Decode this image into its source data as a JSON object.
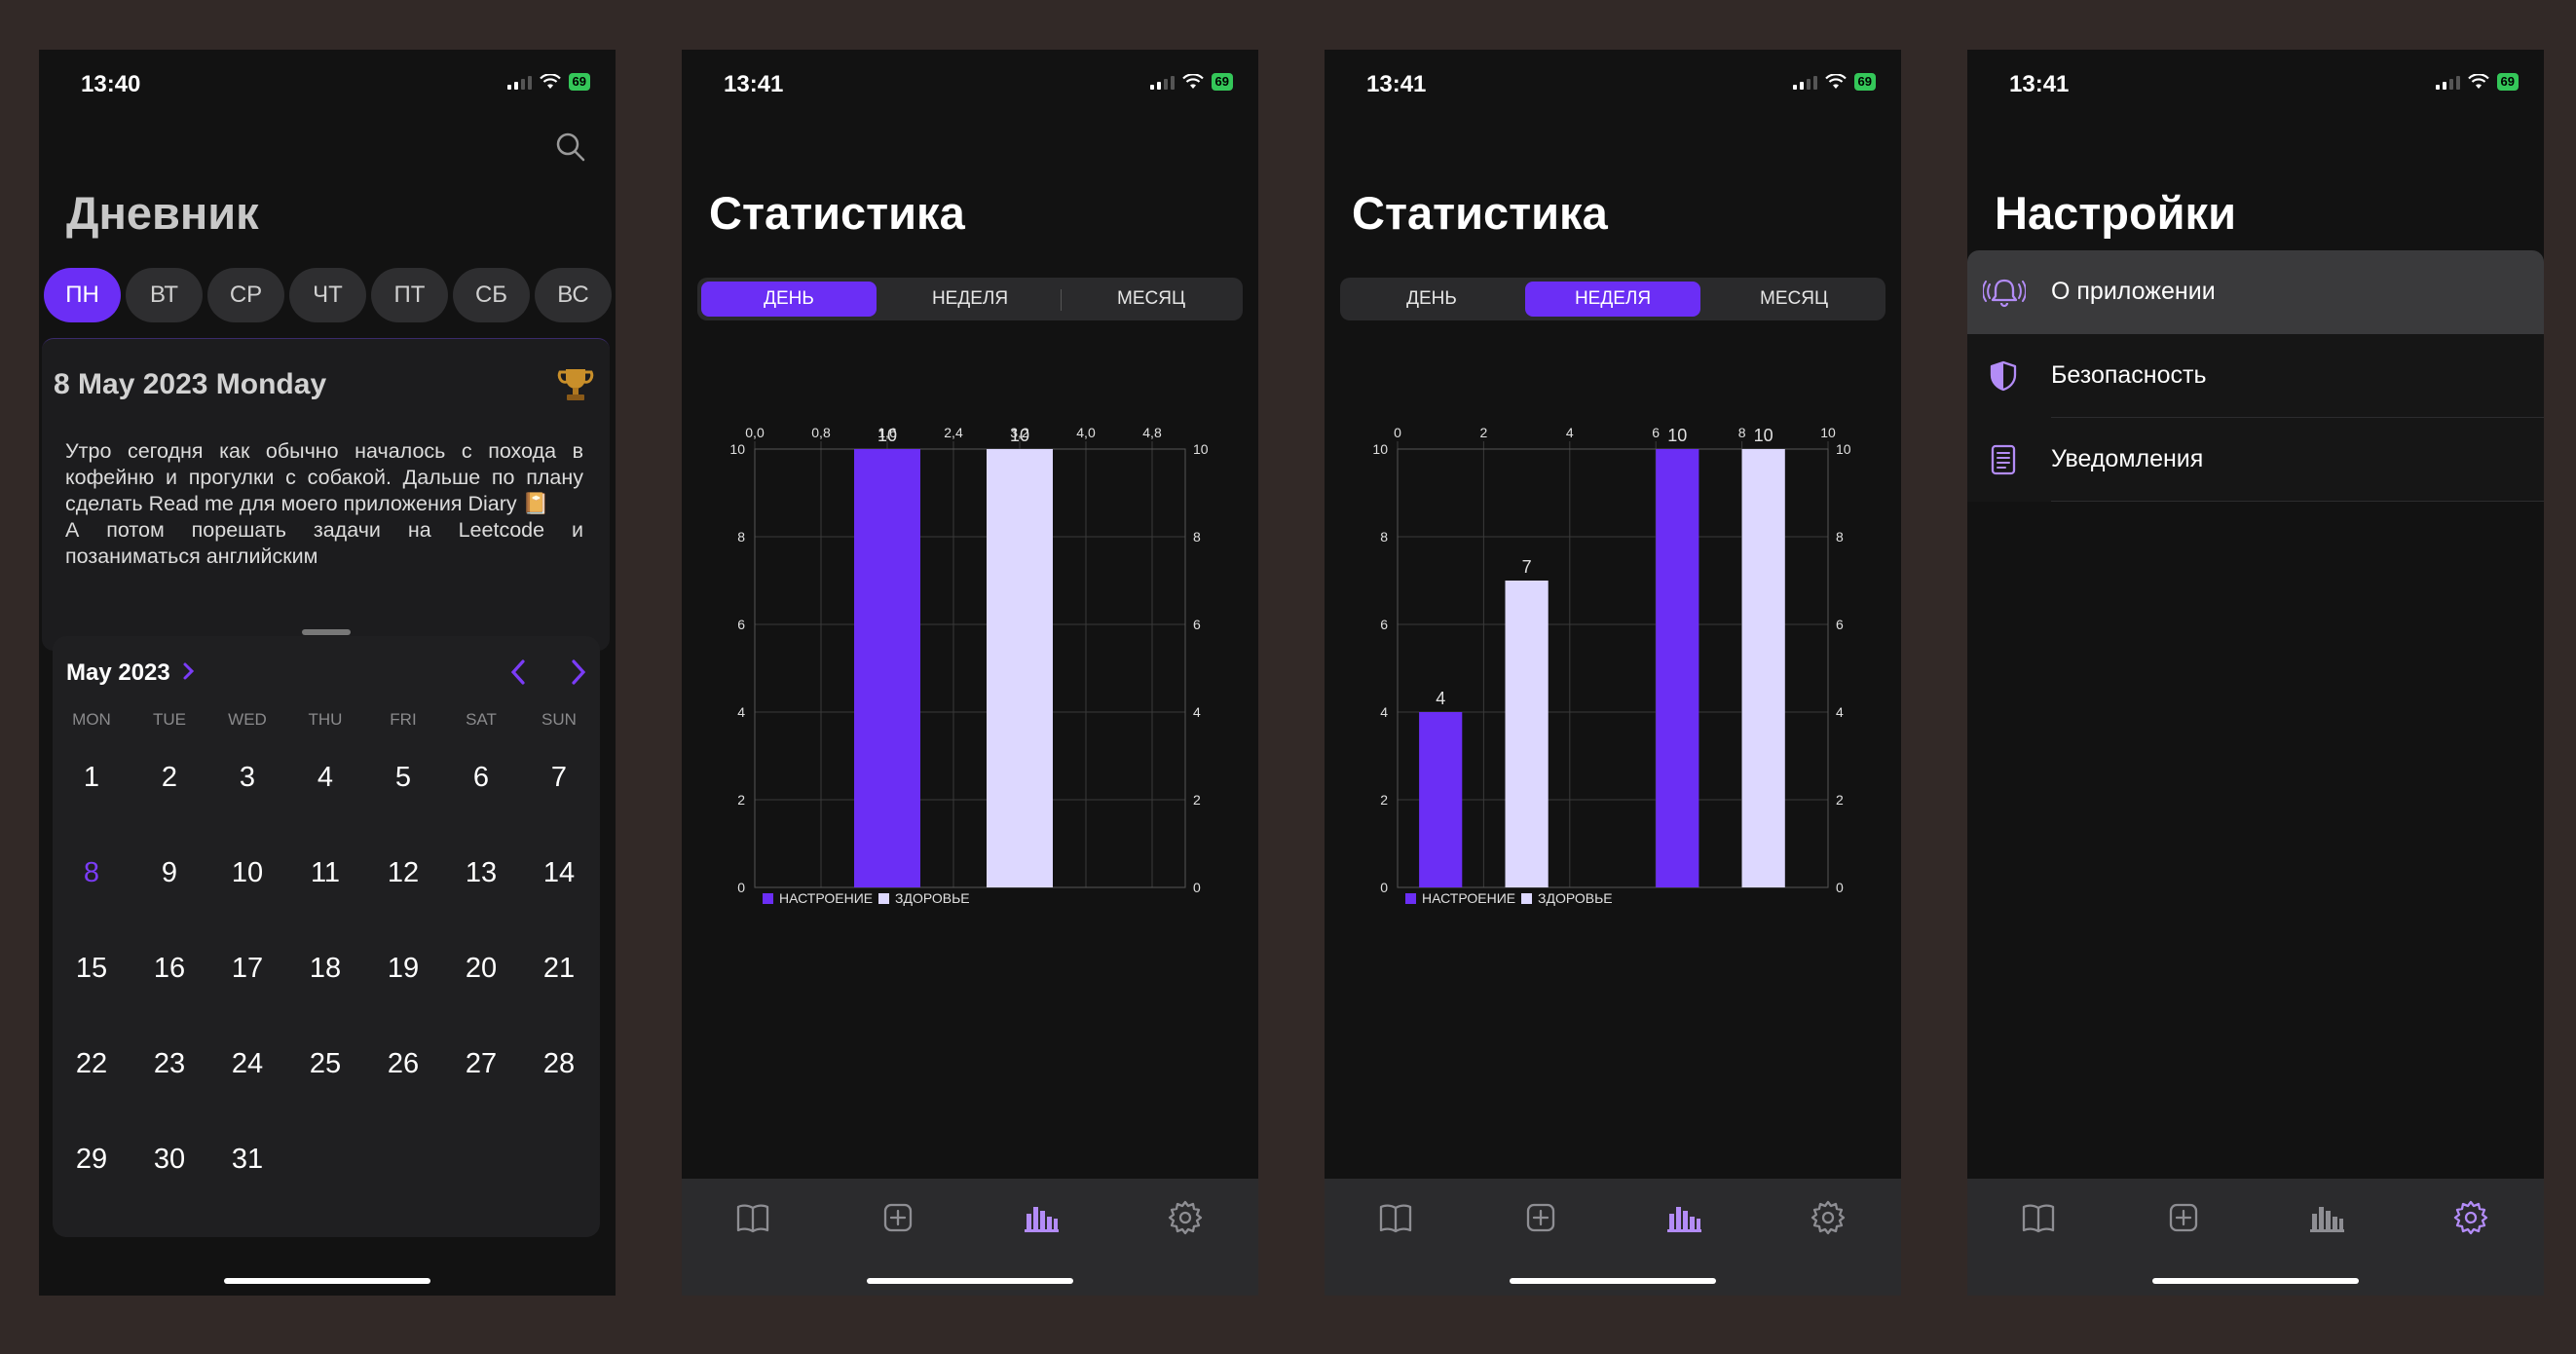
{
  "screens": {
    "diary": {
      "time": "13:40",
      "battery": "69",
      "title": "Дневник",
      "days": [
        {
          "label": "ПН",
          "active": true
        },
        {
          "label": "ВТ"
        },
        {
          "label": "СР"
        },
        {
          "label": "ЧТ"
        },
        {
          "label": "ПТ"
        },
        {
          "label": "СБ"
        },
        {
          "label": "ВС"
        }
      ],
      "entry": {
        "date": "8 May 2023 Monday",
        "text": "Утро сегодня как обычно началось с похода в кофейню и прогулки с собакой. Дальше по плану сделать Read me для моего приложения Diary 📔\nА потом порешать задачи на Leetcode и позаниматься английским"
      },
      "calendar": {
        "month": "May 2023",
        "weekdays": [
          "MON",
          "TUE",
          "WED",
          "THU",
          "FRI",
          "SAT",
          "SUN"
        ],
        "days": [
          "1",
          "2",
          "3",
          "4",
          "5",
          "6",
          "7",
          "8",
          "9",
          "10",
          "11",
          "12",
          "13",
          "14",
          "15",
          "16",
          "17",
          "18",
          "19",
          "20",
          "21",
          "22",
          "23",
          "24",
          "25",
          "26",
          "27",
          "28",
          "29",
          "30",
          "31"
        ],
        "selected": "8"
      }
    },
    "stats_day": {
      "time": "13:41",
      "battery": "69",
      "title": "Статистика",
      "segments": [
        "ДЕНЬ",
        "НЕДЕЛЯ",
        "МЕСЯЦ"
      ],
      "active_segment": 0
    },
    "stats_week": {
      "time": "13:41",
      "battery": "69",
      "title": "Статистика",
      "segments": [
        "ДЕНЬ",
        "НЕДЕЛЯ",
        "МЕСЯЦ"
      ],
      "active_segment": 1
    },
    "settings": {
      "time": "13:41",
      "battery": "69",
      "title": "Настройки",
      "items": [
        {
          "label": "О приложении",
          "icon": "bell-wave-icon"
        },
        {
          "label": "Безопасность",
          "icon": "shield-icon"
        },
        {
          "label": "Уведомления",
          "icon": "note-list-icon"
        }
      ]
    }
  },
  "colors": {
    "accent": "#6b2ef5",
    "light_bar": "#ddd8ff",
    "background": "#121212"
  },
  "tabs": [
    "book-icon",
    "plus-square-icon",
    "chart-bar-icon",
    "gear-icon"
  ],
  "chart_data": [
    {
      "type": "bar",
      "top_axis_ticks": [
        "0,0",
        "0,8",
        "1,6",
        "2,4",
        "3,2",
        "4,0",
        "4,8"
      ],
      "y_ticks": [
        "0",
        "2",
        "4",
        "6",
        "8",
        "10"
      ],
      "ylim": [
        0,
        10
      ],
      "xlim": [
        0,
        5.2
      ],
      "series": [
        {
          "name": "НАСТРОЕНИЕ",
          "color": "#6b2ef5",
          "points": [
            {
              "x": 1.6,
              "y": 10
            }
          ]
        },
        {
          "name": "ЗДОРОВЬЕ",
          "color": "#ddd8ff",
          "points": [
            {
              "x": 3.2,
              "y": 10
            }
          ]
        }
      ],
      "bar_width": 0.8
    },
    {
      "type": "bar",
      "top_axis_ticks": [
        "0",
        "2",
        "4",
        "6",
        "8",
        "10"
      ],
      "y_ticks": [
        "0",
        "2",
        "4",
        "6",
        "8",
        "10"
      ],
      "ylim": [
        0,
        10
      ],
      "xlim": [
        0,
        10
      ],
      "series": [
        {
          "name": "НАСТРОЕНИЕ",
          "color": "#6b2ef5",
          "points": [
            {
              "x": 1,
              "y": 4
            },
            {
              "x": 6.5,
              "y": 10
            }
          ]
        },
        {
          "name": "ЗДОРОВЬЕ",
          "color": "#ddd8ff",
          "points": [
            {
              "x": 3,
              "y": 7
            },
            {
              "x": 8.5,
              "y": 10
            }
          ]
        }
      ],
      "bar_width": 1
    }
  ]
}
